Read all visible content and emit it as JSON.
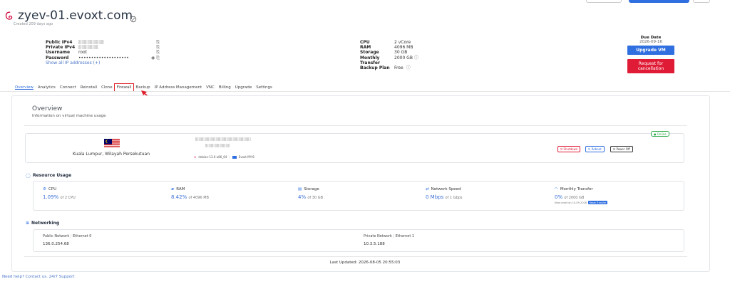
{
  "vm": {
    "hostname": "zyev-01.evoxt.com",
    "created": "Created 209 days ago"
  },
  "details_left": {
    "public_ipv4_label": "Public IPv4",
    "private_ipv4_label": "Private IPv4",
    "username_label": "Username",
    "username_value": "root",
    "password_label": "Password",
    "password_value": "••••••••••••••••••••",
    "show_all_link": "Show all IP addresses (+)"
  },
  "details_right": {
    "cpu_label": "CPU",
    "cpu_value": "2 vCore",
    "ram_label": "RAM",
    "ram_value": "4096 MB",
    "storage_label": "Storage",
    "storage_value": "30 GB",
    "monthly_label": "Monthly",
    "monthly_value": "2000 GB",
    "transfer_label": "Transfer",
    "backup_label": "Backup Plan",
    "backup_value": "Free"
  },
  "due": {
    "label": "Due Date",
    "value": "2026-09-16",
    "upgrade_button": "Upgrade VM",
    "cancel_button": "Request for cancellation"
  },
  "tabs": [
    "Overview",
    "Analytics",
    "Connect",
    "Reinstall",
    "Clone",
    "Firewall",
    "Backup",
    "IP Address Management",
    "VNC",
    "Billing",
    "Upgrade",
    "Settings"
  ],
  "overview": {
    "title": "Overview",
    "subtitle": "Information on virtual machine usage"
  },
  "server": {
    "location": "Kuala Lumpur, Wilayah Persekutuan",
    "os": "debian-13.0-x86_64",
    "node": "Evoxt-MY-8",
    "status": "Online",
    "shutdown_button": "Shutdown",
    "reboot_button": "Reboot",
    "poweroff_button": "Power Off"
  },
  "resource": {
    "title": "Resource Usage",
    "cpu": {
      "label": "CPU",
      "value": "1.09%",
      "of": "of 2 CPU"
    },
    "ram": {
      "label": "RAM",
      "value": "8.42%",
      "of": "of 4096 MB"
    },
    "storage": {
      "label": "Storage",
      "value": "4%",
      "of": "of 30 GB"
    },
    "network": {
      "label": "Network Speed",
      "value": "0 Mbps",
      "of": "of 1 Gbps"
    },
    "transfer": {
      "label": "Monthly Transfer",
      "value": "0%",
      "of": "of 2000 GB",
      "reset": "Next reset on 10-09-2026",
      "reset_button": "Reset Transfer"
    }
  },
  "networking": {
    "title": "Networking",
    "public_label": "Public Network",
    "public_iface": "Ethernet 0",
    "public_ip": "136.0.254.68",
    "private_label": "Private Network",
    "private_iface": "Ethernet 1",
    "private_ip": "10.3.5.188"
  },
  "last_updated": "Last Updated: 2026-08-05 20:55:03",
  "help": "Need help? Contact us. 24/7 Support",
  "colors": {
    "accent": "#2f6fe0",
    "danger": "#e01b35",
    "online": "#2eaa4a"
  }
}
